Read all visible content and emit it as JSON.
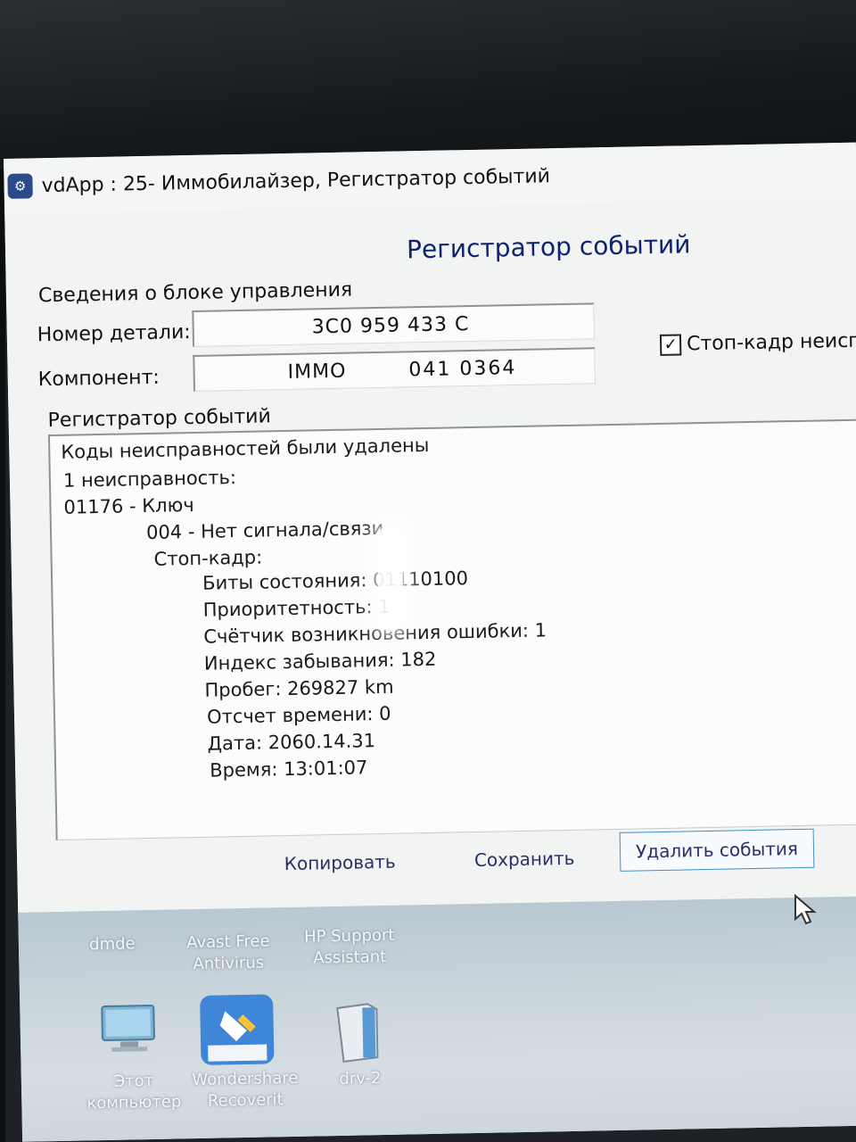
{
  "window": {
    "title": "vdApp : 25- Иммобилайзер,  Регистратор событий",
    "heading": "Регистратор событий"
  },
  "ecu_info": {
    "group_label": "Сведения о блоке управления",
    "part_label": "Номер детали:",
    "part_value": "3C0 959 433 C",
    "component_label": "Компонент:",
    "component_value_a": "IMMO",
    "component_value_b": "041 0364"
  },
  "freeze_frame_checkbox": {
    "label": "Стоп-кадр неиспр",
    "checked": true
  },
  "event_log": {
    "group_label": "Регистратор событий",
    "lines": [
      "Коды неисправностей были удалены",
      "1 неисправность:",
      "01176 - Ключ",
      "004 - Нет сигнала/связи",
      "Стоп-кадр:",
      "Биты состояния: 01110100",
      "Приоритетность: 1",
      "Счётчик возникновения ошибки: 1",
      "Индекс забывания: 182",
      "Пробег: 269827 km",
      "Отсчет времени: 0",
      "Дата: 2060.14.31",
      "Время: 13:01:07"
    ]
  },
  "buttons": {
    "copy": "Копировать",
    "save": "Сохранить",
    "delete": "Удалить события"
  },
  "desktop_icons": [
    {
      "label": "dmde",
      "icon": "app-icon"
    },
    {
      "label": "Avast Free Antivirus",
      "icon": "avast-icon"
    },
    {
      "label": "HP Support Assistant",
      "icon": "hp-icon"
    },
    {
      "label": "Этот компьютер",
      "icon": "computer-icon"
    },
    {
      "label": "Wondershare Recoverit",
      "icon": "recoverit-icon"
    },
    {
      "label": "drv-2",
      "icon": "folder-icon"
    }
  ]
}
